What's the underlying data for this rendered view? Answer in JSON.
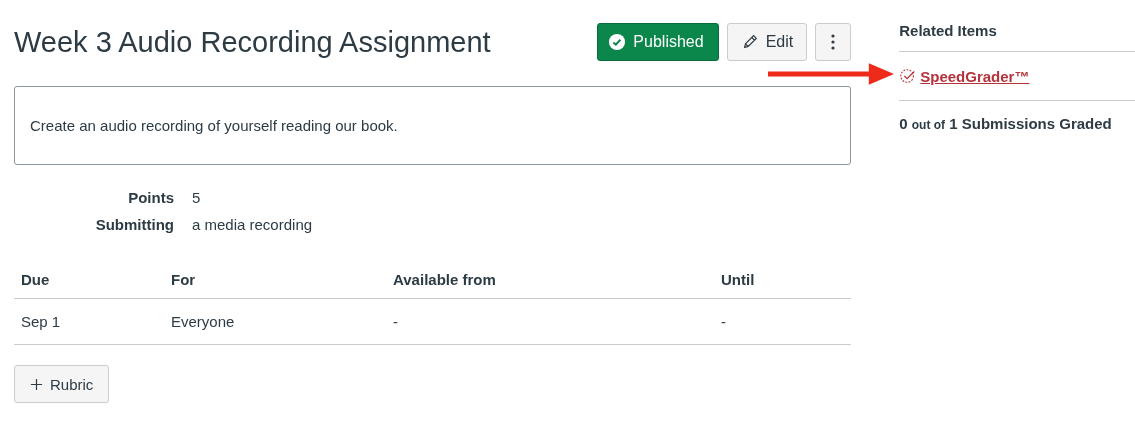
{
  "title": "Week 3 Audio Recording Assignment",
  "actions": [
    {
      "kind": "published",
      "label": "Published"
    },
    {
      "kind": "edit",
      "label": "Edit"
    },
    {
      "kind": "more"
    }
  ],
  "description": "Create an audio recording of yourself reading our book.",
  "details": [
    {
      "label": "Points",
      "value": "5"
    },
    {
      "label": "Submitting",
      "value": "a media recording"
    }
  ],
  "table": {
    "columns": [
      "Due",
      "For",
      "Available from",
      "Until"
    ],
    "rows": [
      [
        "Sep 1",
        "Everyone",
        "-",
        "-"
      ]
    ]
  },
  "rubric_button": "Rubric",
  "sidebar": {
    "heading": "Related Items",
    "link": "SpeedGrader™",
    "graded": {
      "count": "0",
      "connector": "out of",
      "total": "1 Submissions Graded"
    }
  }
}
